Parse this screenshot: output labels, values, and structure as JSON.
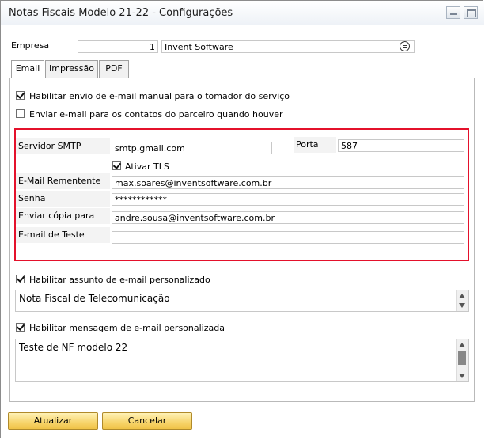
{
  "window": {
    "title": "Notas Fiscais Modelo 21-22  - Configurações"
  },
  "empresa": {
    "label": "Empresa",
    "code": "1",
    "name": "Invent Software"
  },
  "tabs": [
    {
      "label": "Email",
      "active": true
    },
    {
      "label": "Impressão",
      "active": false
    },
    {
      "label": "PDF",
      "active": false
    }
  ],
  "options": {
    "manual_email": {
      "label": "Habilitar envio de e-mail manual para o tomador do serviço",
      "checked": true
    },
    "partner_contacts": {
      "label": "Enviar e-mail para os contatos do parceiro quando houver",
      "checked": false
    }
  },
  "smtp": {
    "server_label": "Servidor SMTP",
    "server_value": "smtp.gmail.com",
    "port_label": "Porta",
    "port_value": "587",
    "tls_label": "Ativar TLS",
    "tls_checked": true,
    "sender_label": "E-Mail Rementente",
    "sender_value": "max.soares@inventsoftware.com.br",
    "password_label": "Senha",
    "password_value": "************",
    "cc_label": "Enviar cópia para",
    "cc_value": "andre.sousa@inventsoftware.com.br",
    "test_label": "E-mail de Teste",
    "test_value": ""
  },
  "subject": {
    "label": "Habilitar assunto de e-mail personalizado",
    "checked": true,
    "value": "Nota Fiscal de Telecomunicação"
  },
  "message": {
    "label": "Habilitar mensagem de e-mail personalizada",
    "checked": true,
    "value": "Teste de NF modelo 22"
  },
  "buttons": {
    "update": "Atualizar",
    "cancel": "Cancelar"
  },
  "colors": {
    "highlight_border": "#e4112b",
    "button_fill": "#f7d46b"
  },
  "icons": [
    "minimize-icon",
    "maximize-icon",
    "lookup-list-icon",
    "checkbox-check-icon",
    "scroll-up-icon",
    "scroll-down-icon"
  ]
}
